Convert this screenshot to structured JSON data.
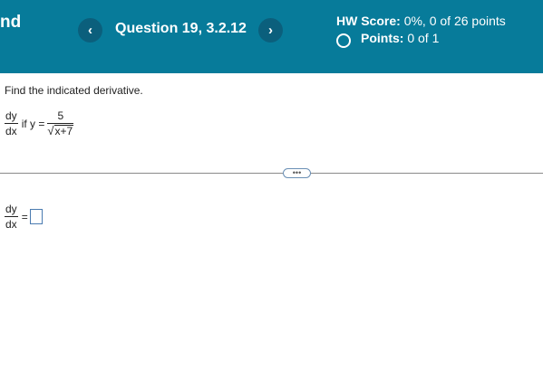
{
  "header": {
    "left_text": "nd",
    "prev_label": "‹",
    "next_label": "›",
    "question_title": "Question 19, 3.2.12",
    "score_label": "HW Score:",
    "score_value": "0%, 0 of 26 points",
    "points_label": "Points:",
    "points_value": "0 of 1"
  },
  "problem": {
    "instruction": "Find the indicated derivative.",
    "dy": "dy",
    "dx": "dx",
    "if_text": "if y =",
    "numerator": "5",
    "radicand": "x+7",
    "radical": "√"
  },
  "more_button_label": "•••",
  "answer": {
    "dy": "dy",
    "dx": "dx",
    "equals": "=",
    "value": ""
  },
  "colors": {
    "header_bg": "#077b9a",
    "nav_button_bg": "#0b5f7c",
    "answer_box_border": "#4a7bb0"
  }
}
